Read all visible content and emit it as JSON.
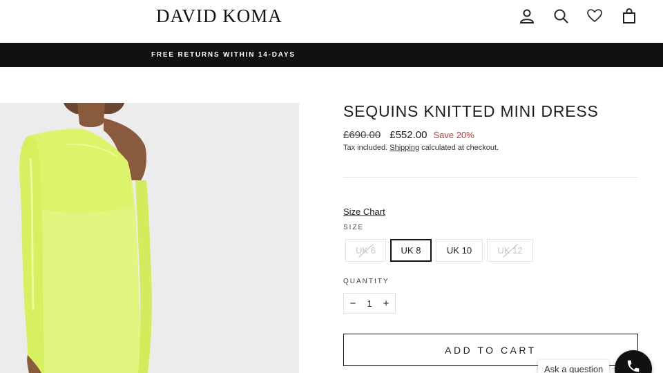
{
  "header": {
    "logo": "DAVID KOMA",
    "icons": [
      "account-icon",
      "search-icon",
      "wishlist-heart-icon",
      "cart-bag-icon"
    ]
  },
  "announcement": {
    "text": "FREE RETURNS WITHIN 14-DAYS"
  },
  "product": {
    "title": "SEQUINS KNITTED MINI DRESS",
    "original_price": "£690.00",
    "sale_price": "£552.00",
    "save_text": "Save 20%",
    "tax_prefix": "Tax included.",
    "shipping_link": "Shipping",
    "tax_suffix": "calculated at checkout.",
    "size_chart": "Size Chart",
    "size_label": "SIZE",
    "sizes": [
      {
        "label": "UK 6",
        "state": "sold-out"
      },
      {
        "label": "UK 8",
        "state": "selected"
      },
      {
        "label": "UK 10",
        "state": "available"
      },
      {
        "label": "UK 12",
        "state": "sold-out"
      }
    ],
    "quantity_label": "QUANTITY",
    "quantity_minus": "−",
    "quantity_value": "1",
    "quantity_plus": "+",
    "add_to_cart": "ADD TO CART",
    "image_colors": {
      "dress": "#e6f782",
      "background": "#ececec",
      "skin": "#8a5a3c"
    }
  },
  "chat": {
    "ask_label": "Ask a question",
    "icon": "phone-icon"
  },
  "colors": {
    "announce_bg": "#111111",
    "sale": "#c0392b",
    "text": "#1c1d1d"
  }
}
